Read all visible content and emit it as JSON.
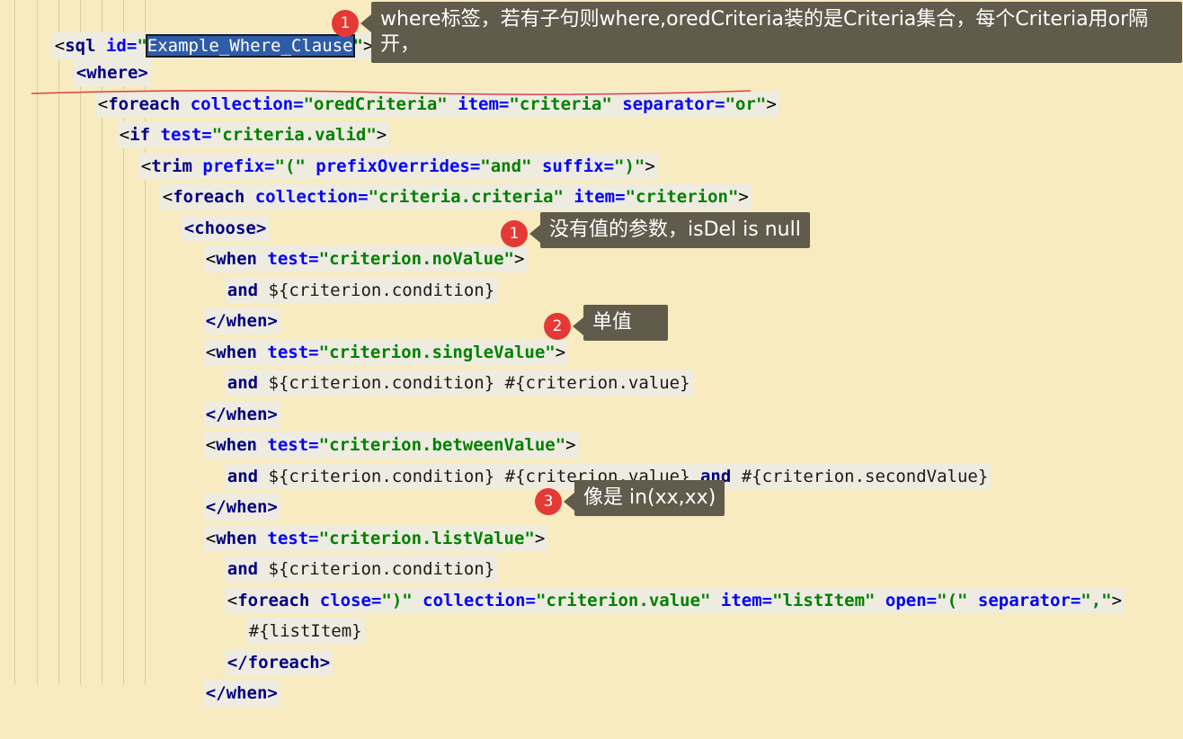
{
  "code": {
    "l1": {
      "open": "<",
      "tag": "sql",
      "attr1": " id=",
      "q1": "\"",
      "selected": "Example_Where_Clause",
      "q2": "\"",
      "close": ">"
    },
    "l2": {
      "tag": "<where>"
    },
    "l3": {
      "open": "<",
      "tag": "foreach",
      "a1": " collection=",
      "v1": "\"oredCriteria\"",
      "a2": " item=",
      "v2": "\"criteria\"",
      "a3": " separator=",
      "v3": "\"or\"",
      "close": ">"
    },
    "l4": {
      "open": "<",
      "tag": "if",
      "a1": " test=",
      "v1": "\"criteria.valid\"",
      "close": ">"
    },
    "l5": {
      "open": "<",
      "tag": "trim",
      "a1": " prefix=",
      "v1": "\"(\"",
      "a2": " prefixOverrides=",
      "v2": "\"and\"",
      "a3": " suffix=",
      "v3": "\")\"",
      "close": ">"
    },
    "l6": {
      "open": "<",
      "tag": "foreach",
      "a1": " collection=",
      "v1": "\"criteria.criteria\"",
      "a2": " item=",
      "v2": "\"criterion\"",
      "close": ">"
    },
    "l7": {
      "tag": "<choose>"
    },
    "l8": {
      "open": "<",
      "tag": "when",
      "a1": " test=",
      "v1": "\"criterion.noValue\"",
      "close": ">"
    },
    "l9": {
      "kw": "and",
      "txt": " ${criterion.condition}"
    },
    "l10": {
      "tag": "</when>"
    },
    "l11": {
      "open": "<",
      "tag": "when",
      "a1": " test=",
      "v1": "\"criterion.singleValue\"",
      "close": ">"
    },
    "l12": {
      "kw": "and",
      "txt": " ${criterion.condition} #{criterion.value}"
    },
    "l13": {
      "tag": "</when>"
    },
    "l14": {
      "open": "<",
      "tag": "when",
      "a1": " test=",
      "v1": "\"criterion.betweenValue\"",
      "close": ">"
    },
    "l15": {
      "kw": "and",
      "txt1": " ${criterion.condition} #{criterion.value} ",
      "kw2": "and",
      "txt2": " #{criterion.secondValue}"
    },
    "l16": {
      "tag": "</when>"
    },
    "l17": {
      "open": "<",
      "tag": "when",
      "a1": " test=",
      "v1": "\"criterion.listValue\"",
      "close": ">"
    },
    "l18": {
      "kw": "and",
      "txt": " ${criterion.condition}"
    },
    "l19": {
      "open": "<",
      "tag": "foreach",
      "a1": " close=",
      "v1": "\")\"",
      "a2": " collection=",
      "v2": "\"criterion.value\"",
      "a3": " item=",
      "v3": "\"listItem\"",
      "a4": " open=",
      "v4": "\"(\"",
      "a5": " separator=",
      "v5": "\",\"",
      "close": ">"
    },
    "l20": {
      "txt": "#{listItem}"
    },
    "l21": {
      "tag": "</foreach>"
    },
    "l22": {
      "tag": "</when>"
    }
  },
  "annotations": [
    {
      "num": "1",
      "text": "where标签，若有子句则where,oredCriteria装的是Criteria集合，每个Criteria用or隔开，"
    },
    {
      "num": "1",
      "text": "没有值的参数，isDel is null"
    },
    {
      "num": "2",
      "text": "单值"
    },
    {
      "num": "3",
      "text": "像是 in(xx,xx)"
    }
  ],
  "colors": {
    "background": "#f7ebbf",
    "tag": "#000080",
    "attr": "#0000ff",
    "value": "#008000",
    "callout": "#605b4b",
    "badge": "#e53935",
    "selection": "#2e5ca8"
  }
}
